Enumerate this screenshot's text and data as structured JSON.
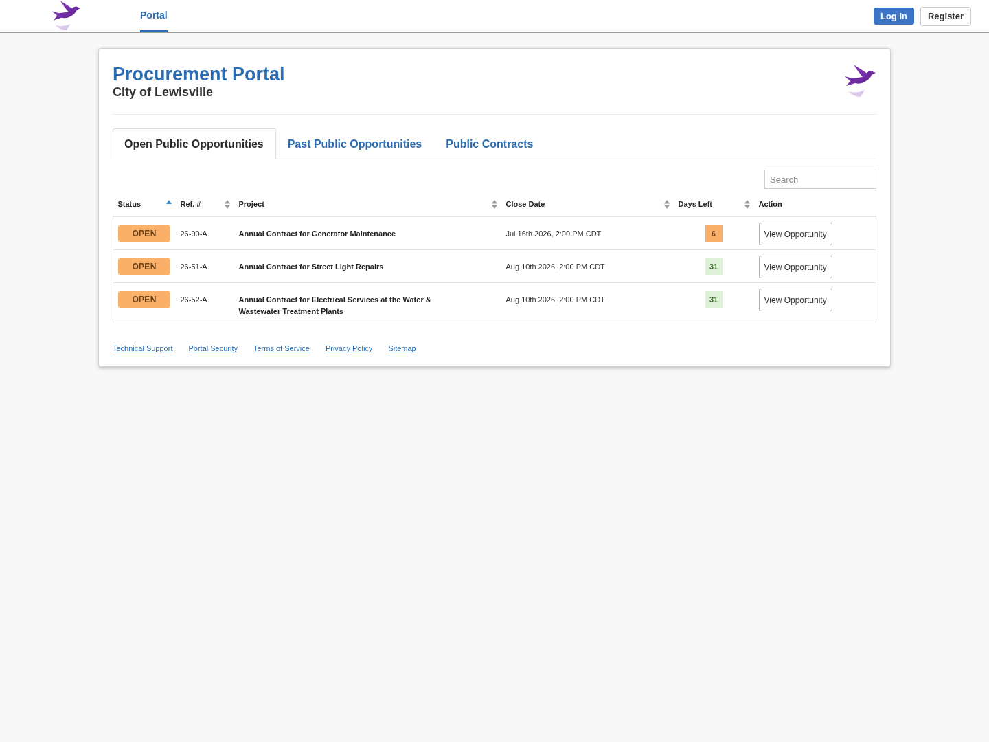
{
  "top_nav": {
    "tabs": [
      {
        "label": "Portal",
        "selected": true
      }
    ],
    "buttons": [
      {
        "label": "Log In",
        "kind": "primary"
      },
      {
        "label": "Register",
        "kind": "secondary"
      }
    ]
  },
  "header": {
    "title": "Procurement Portal",
    "subtitle": "City of Lewisville"
  },
  "tabs": [
    {
      "label": "Open Public Opportunities",
      "selected": true
    },
    {
      "label": "Past Public Opportunities",
      "selected": false
    },
    {
      "label": "Public Contracts",
      "selected": false
    }
  ],
  "search": {
    "placeholder": "Search"
  },
  "table": {
    "columns": [
      {
        "label": "Status",
        "sortable": true,
        "sorted": true
      },
      {
        "label": "Ref. #",
        "sortable": true,
        "sorted": false
      },
      {
        "label": "Project",
        "sortable": true,
        "sorted": false
      },
      {
        "label": "Close Date",
        "sortable": true,
        "sorted": false
      },
      {
        "label": "Days Left",
        "sortable": true,
        "sorted": false
      },
      {
        "label": "Action",
        "sortable": false
      }
    ],
    "rows": [
      {
        "status": "OPEN",
        "ref": "26-90-A",
        "project": "Annual Contract for Generator Maintenance",
        "close_date": "Jul 16th 2026, 2:00 PM CDT",
        "days_left": {
          "text": "6",
          "color": "#fbb06a"
        },
        "action": "View Opportunity"
      },
      {
        "status": "OPEN",
        "ref": "26-51-A",
        "project": "Annual Contract for Street Light Repairs",
        "close_date": "Aug 10th 2026, 2:00 PM CDT",
        "days_left": {
          "text": "31",
          "color": "#dff0d8"
        },
        "action": "View Opportunity"
      },
      {
        "status": "OPEN",
        "ref": "26-52-A",
        "project": "Annual Contract for Electrical Services at the Water & Wastewater Treatment Plants",
        "close_date": "Aug 10th 2026, 2:00 PM CDT",
        "days_left": {
          "text": "31",
          "color": "#dff0d8"
        },
        "action": "View Opportunity"
      }
    ]
  },
  "footer_links": [
    "Technical Support",
    "Portal Security",
    "Terms of Service",
    "Privacy Policy",
    "Sitemap"
  ]
}
